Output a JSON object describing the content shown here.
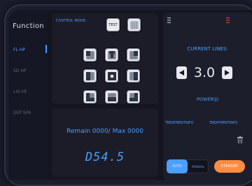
{
  "colors": {
    "accent": "#4b9fff",
    "inactive_text": "#5d6173",
    "standby_orange": "#ff8c42",
    "button_light": "#e7e9ee",
    "indicator_red": "#e04040"
  },
  "sidebar": {
    "title": "Function",
    "items": [
      {
        "label": "FL HP",
        "active": true
      },
      {
        "label": "SD HP",
        "active": false
      },
      {
        "label": "LIO HF",
        "active": false
      },
      {
        "label": "DEP SPA",
        "active": false
      }
    ]
  },
  "control": {
    "label": "CONTROL MODE:",
    "test_label": "TEST",
    "grid_icons": [
      "full-grid-icon",
      "pattern-a-icon",
      "pattern-b-icon",
      "pattern-c-icon",
      "pattern-d-icon",
      "center-dot-icon",
      "pattern-e-icon",
      "pattern-f-icon",
      "pattern-g-icon",
      "pattern-h-icon"
    ]
  },
  "counter": {
    "remain_text": "Remain 0000/ Max 0000",
    "lcd_value": "D54.5"
  },
  "right_panel": {
    "topbar_left_icon": "hamburger-icon",
    "topbar_right_icon": "red-indicator-icon",
    "current_lines_label": "CURRENT LINES:",
    "current_lines_value": "3.0",
    "left_arrow_icon": "left-triangle-icon",
    "right_arrow_icon": "right-triangle-icon",
    "power_label": "POWER(J)",
    "treatment_left": "TREATMENTINFO",
    "treatment_right": "TREATMENTINFO",
    "trash_icon": "trash-icon",
    "mode_auto": "AUTO",
    "mode_manual": "MANUAL",
    "standby_label": "STANDBY"
  }
}
